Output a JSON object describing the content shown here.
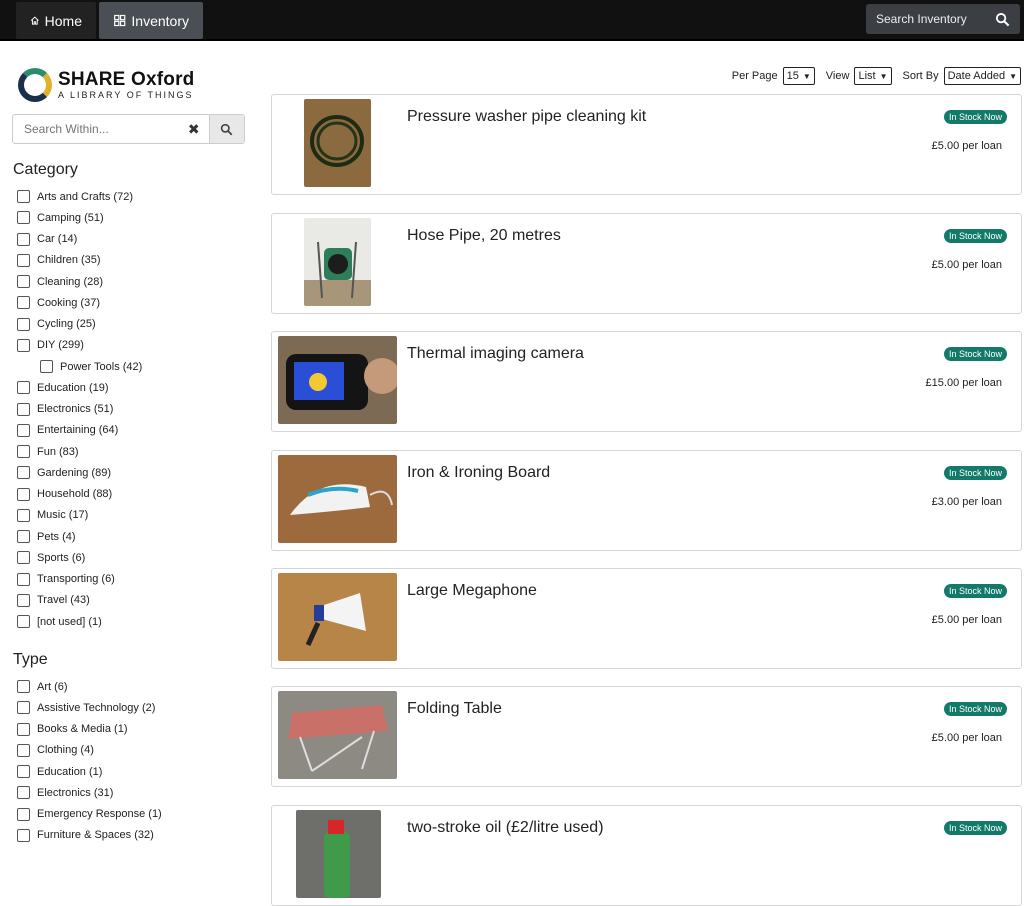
{
  "nav": {
    "home": "Home",
    "inventory": "Inventory",
    "search": "Search Inventory"
  },
  "brand": {
    "title": "SHARE Oxford",
    "subtitle": "A LIBRARY OF THINGS"
  },
  "sidebar": {
    "search_placeholder": "Search Within...",
    "category_title": "Category",
    "categories": [
      "Arts and Crafts (72)",
      "Camping (51)",
      "Car (14)",
      "Children (35)",
      "Cleaning (28)",
      "Cooking (37)",
      "Cycling (25)",
      "DIY (299)",
      "Power Tools (42)",
      "Education (19)",
      "Electronics (51)",
      "Entertaining (64)",
      "Fun (83)",
      "Gardening (89)",
      "Household (88)",
      "Music (17)",
      "Pets (4)",
      "Sports (6)",
      "Transporting (6)",
      "Travel (43)",
      "[not used] (1)"
    ],
    "type_title": "Type",
    "types": [
      "Art (6)",
      "Assistive Technology (2)",
      "Books & Media (1)",
      "Clothing (4)",
      "Education (1)",
      "Electronics (31)",
      "Emergency Response (1)",
      "Furniture & Spaces (32)"
    ]
  },
  "controls": {
    "per_page_label": "Per Page",
    "per_page": "15",
    "view_label": "View",
    "view": "List",
    "sort_label": "Sort By",
    "sort": "Date Added"
  },
  "items": [
    {
      "title": "Pressure washer pipe cleaning kit",
      "badge": "In Stock Now",
      "price": "£5.00 per loan"
    },
    {
      "title": "Hose Pipe, 20 metres",
      "badge": "In Stock Now",
      "price": "£5.00 per loan"
    },
    {
      "title": "Thermal imaging camera",
      "badge": "In Stock Now",
      "price": "£15.00 per loan"
    },
    {
      "title": "Iron & Ironing Board",
      "badge": "In Stock Now",
      "price": "£3.00 per loan"
    },
    {
      "title": "Large Megaphone",
      "badge": "In Stock Now",
      "price": "£5.00 per loan"
    },
    {
      "title": "Folding Table",
      "badge": "In Stock Now",
      "price": "£5.00 per loan"
    },
    {
      "title": "two-stroke oil (£2/litre used)",
      "badge": "In Stock Now",
      "price": ""
    }
  ],
  "colors": {
    "topbar": "#111111",
    "badge": "#137a6a"
  }
}
